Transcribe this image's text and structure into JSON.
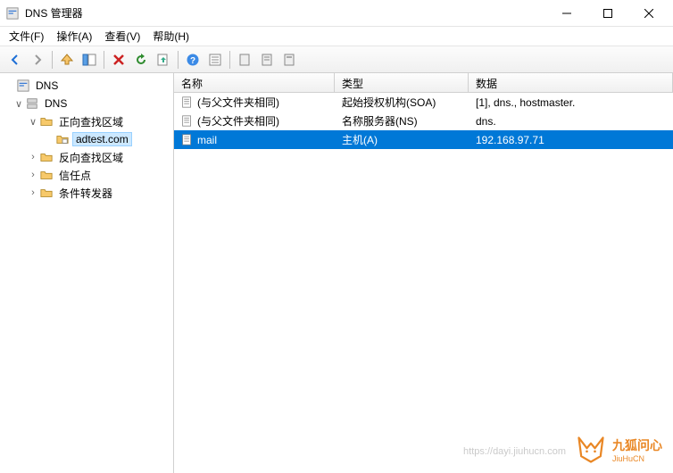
{
  "window": {
    "title": "DNS 管理器"
  },
  "menu": {
    "file": "文件(F)",
    "action": "操作(A)",
    "view": "查看(V)",
    "help": "帮助(H)"
  },
  "tree": {
    "root": "DNS",
    "server": "DNS",
    "forward": "正向查找区域",
    "zone": "adtest.com",
    "reverse": "反向查找区域",
    "trust": "信任点",
    "conditional": "条件转发器"
  },
  "columns": {
    "name": "名称",
    "type": "类型",
    "data": "数据"
  },
  "rows": [
    {
      "name": "(与父文件夹相同)",
      "type": "起始授权机构(SOA)",
      "data": "[1], dns., hostmaster."
    },
    {
      "name": "(与父文件夹相同)",
      "type": "名称服务器(NS)",
      "data": "dns."
    },
    {
      "name": "mail",
      "type": "主机(A)",
      "data": "192.168.97.71"
    }
  ],
  "watermark": {
    "brand": "九狐问心",
    "sub": "JiuHuCN",
    "url": "https://dayi.jiuhucn.com"
  }
}
